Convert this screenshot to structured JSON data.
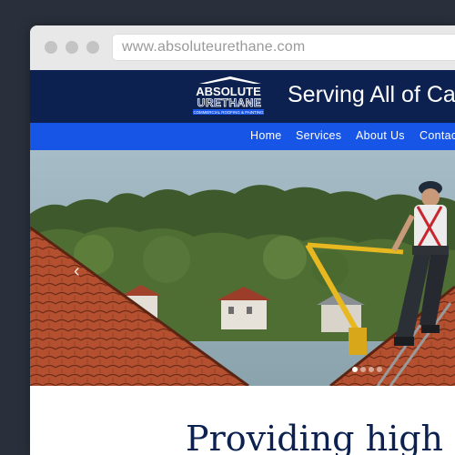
{
  "browser": {
    "url": "www.absoluteurethane.com"
  },
  "header": {
    "logo": {
      "line1": "ABSOLUTE",
      "line2": "URETHANE",
      "line3": "COMMERCIAL ROOFING & PAINTING"
    },
    "tagline": "Serving All of Ca"
  },
  "nav": {
    "items": [
      "Home",
      "Services",
      "About Us",
      "Contac"
    ]
  },
  "hero": {
    "prev_icon": "chevron-left-icon",
    "slide_count": 4,
    "active_slide": 1
  },
  "content": {
    "headline": "Providing high qu"
  },
  "colors": {
    "page_background": "#2a303b",
    "header_bg": "#0c2150",
    "nav_bg": "#1755e6",
    "headline_color": "#0c2150"
  }
}
